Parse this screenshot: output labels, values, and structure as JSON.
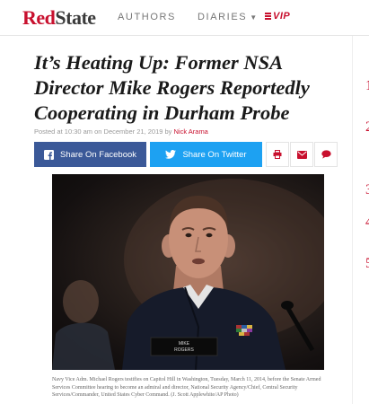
{
  "header": {
    "logo_part1": "Red",
    "logo_part2": "State",
    "nav": {
      "authors": "AUTHORS",
      "diaries": "DIARIES",
      "vip": "VIP"
    }
  },
  "article": {
    "headline": "It’s Heating Up: Former NSA Director Mike Rogers Reportedly Cooperating in Durham Probe",
    "byline_prefix": "Posted at 10:30 am on December 21, 2019 by ",
    "author": "Nick Arama",
    "share": {
      "facebook_label": "Share On Facebook",
      "twitter_label": "Share On Twitter"
    },
    "photo": {
      "nameplate_line1": "MIKE",
      "nameplate_line2": "ROGERS"
    },
    "caption": "Navy Vice Adm. Michael Rogers testifies on Capitol Hill in Washington, Tuesday, March 11, 2014, before the Senate Armed Services Committee hearing to become an admiral and director, National Security Agency/Chief, Central Security Services/Commander, United States Cyber Command. (J. Scott Applewhite/AP Photo)"
  },
  "right_rail": {
    "numbers": [
      "1",
      "2",
      "3",
      "4",
      "5"
    ]
  },
  "colors": {
    "brand_red": "#c8102e",
    "facebook": "#3b5998",
    "twitter": "#1da1f2"
  }
}
